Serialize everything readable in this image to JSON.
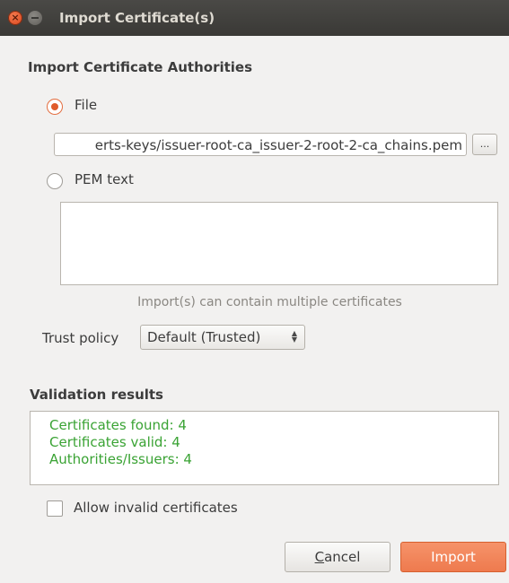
{
  "window": {
    "title": "Import Certificate(s)",
    "close_glyph": "×"
  },
  "import_section": {
    "heading": "Import Certificate Authorities",
    "file_option": {
      "label": "File",
      "selected": true
    },
    "file_path": "erts-keys/issuer-root-ca_issuer-2-root-2-ca_chains.pem",
    "browse_label": "...",
    "pem_option": {
      "label": "PEM text",
      "selected": false
    },
    "pem_text": "",
    "hint": "Import(s) can contain multiple certificates"
  },
  "trust": {
    "label": "Trust policy",
    "selected": "Default (Trusted)"
  },
  "validation": {
    "heading": "Validation results",
    "lines": [
      "Certificates found: 4",
      "Certificates valid: 4",
      "Authorities/Issuers: 4"
    ],
    "line_color": "#3aa334"
  },
  "allow_invalid": {
    "label": "Allow invalid certificates",
    "checked": false
  },
  "buttons": {
    "cancel_mnemonic": "C",
    "cancel_rest": "ancel",
    "import": "Import"
  },
  "colors": {
    "accent": "#ee7a4e",
    "titlebar": "#3d3c39"
  }
}
